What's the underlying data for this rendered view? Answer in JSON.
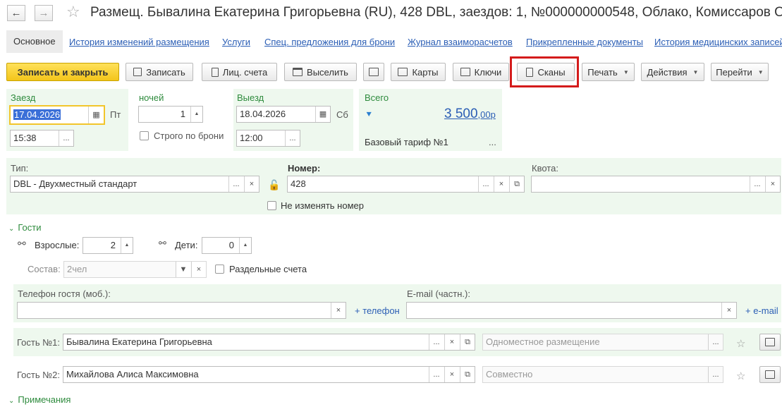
{
  "window": {
    "title": "Размещ. Бывалина Екатерина Григорьевна (RU), 428 DBL, заездов: 1, №000000000548, Облако, Комиссаров О"
  },
  "tabs": [
    "Основное",
    "История изменений размещения",
    "Услуги",
    "Спец. предложения для брони",
    "Журнал взаиморасчетов",
    "Прикрепленные документы",
    "История медицинских записей"
  ],
  "toolbar": {
    "save_close": "Записать и закрыть",
    "save": "Записать",
    "account": "Лиц. счета",
    "checkout": "Выселить",
    "cards": "Карты",
    "keys": "Ключи",
    "scans": "Сканы",
    "print": "Печать",
    "actions": "Действия",
    "goto": "Перейти"
  },
  "checkin": {
    "label": "Заезд",
    "date": "17.04.2026",
    "weekday": "Пт",
    "time": "15:38"
  },
  "nights": {
    "label": "ночей",
    "value": "1",
    "strict_label": "Строго по брони"
  },
  "checkout": {
    "label": "Выезд",
    "date": "18.04.2026",
    "weekday": "Сб",
    "time": "12:00"
  },
  "total": {
    "label": "Всего",
    "amount_main": "3 500",
    "amount_frac": ",00",
    "currency": "р",
    "tariff": "Базовый тариф №1",
    "more": "..."
  },
  "room": {
    "type_label": "Тип:",
    "type_value": "DBL - Двухместный стандарт",
    "number_label": "Номер:",
    "number_value": "428",
    "quota_label": "Квота:",
    "quota_value": "",
    "keep_number_label": "Не изменять номер"
  },
  "guests": {
    "section_label": "Гости",
    "adults_label": "Взрослые:",
    "adults_value": "2",
    "children_label": "Дети:",
    "children_value": "0",
    "composition_label": "Состав:",
    "composition_value": "2чел",
    "separate_accounts_label": "Раздельные счета",
    "phone_label": "Телефон гостя (моб.):",
    "phone_value": "",
    "add_phone": "+ телефон",
    "email_label": "E-mail (частн.):",
    "email_value": "",
    "add_email": "+ e-mail",
    "list": [
      {
        "label": "Гость №1:",
        "name": "Бывалина Екатерина Григорьевна",
        "placement": "Одноместное размещение"
      },
      {
        "label": "Гость №2:",
        "name": "Михайлова Алиса Максимовна",
        "placement": "Совместно"
      }
    ]
  },
  "notes": {
    "section_label": "Примечания"
  },
  "colors": {
    "accent_yellow": "#f3c51a",
    "panel_green": "#eef8ee",
    "label_green": "#2e8b3d",
    "link_blue": "#2b5eb5",
    "highlight_red": "#d41b1b"
  }
}
